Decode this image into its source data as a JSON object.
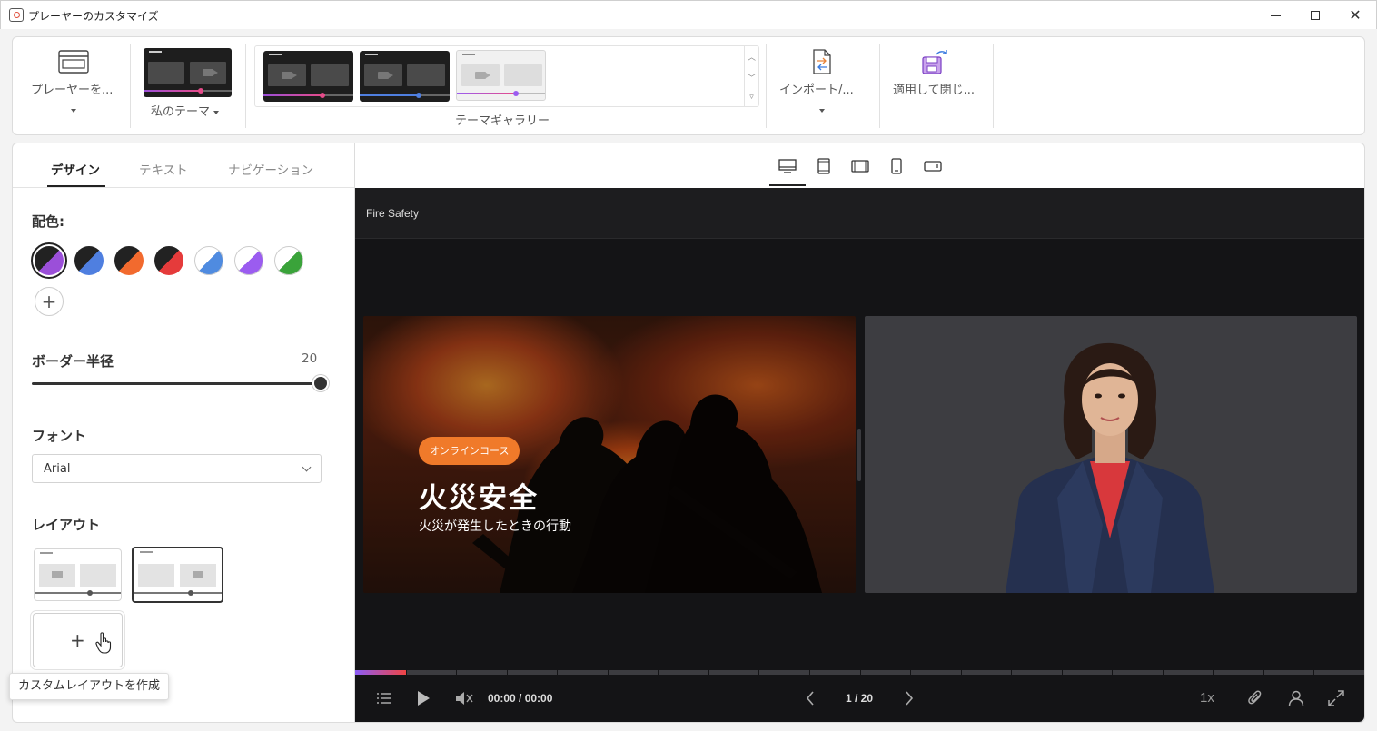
{
  "window": {
    "title": "プレーヤーのカスタマイズ"
  },
  "ribbon": {
    "player_label": "プレーヤーを...",
    "my_theme_label": "私のテーマ",
    "gallery_label": "テーマギャラリー",
    "import_label": "インポート/...",
    "apply_label": "適用して閉じ..."
  },
  "tabs": [
    {
      "label": "デザイン",
      "active": true
    },
    {
      "label": "テキスト",
      "active": false
    },
    {
      "label": "ナビゲーション",
      "active": false
    }
  ],
  "design": {
    "color_scheme_title": "配色:",
    "color_schemes": [
      {
        "base": "#222222",
        "accent": "#9b4fd9",
        "selected": true
      },
      {
        "base": "#222222",
        "accent": "#4f7fe0"
      },
      {
        "base": "#222222",
        "accent": "#f26a2e"
      },
      {
        "base": "#222222",
        "accent": "#e53b3b"
      },
      {
        "base": "#ffffff",
        "accent": "#4f8be0"
      },
      {
        "base": "#ffffff",
        "accent": "#9b5cf0"
      },
      {
        "base": "#ffffff",
        "accent": "#3aa33a"
      }
    ],
    "border_radius_title": "ボーダー半径",
    "border_radius_value": "20",
    "font_title": "フォント",
    "font_value": "Arial",
    "layout_title": "レイアウト",
    "custom_layout_tooltip": "カスタムレイアウトを作成"
  },
  "player": {
    "course_title": "Fire Safety",
    "slide_badge": "オンラインコース",
    "slide_title": "火災安全",
    "slide_subtitle": "火災が発生したときの行動",
    "progress": 0.05,
    "time": "00:00 / 00:00",
    "page": "1 / 20",
    "speed": "1x"
  },
  "colors": {
    "accent": "#f07a2a",
    "player_bg": "#141416"
  }
}
